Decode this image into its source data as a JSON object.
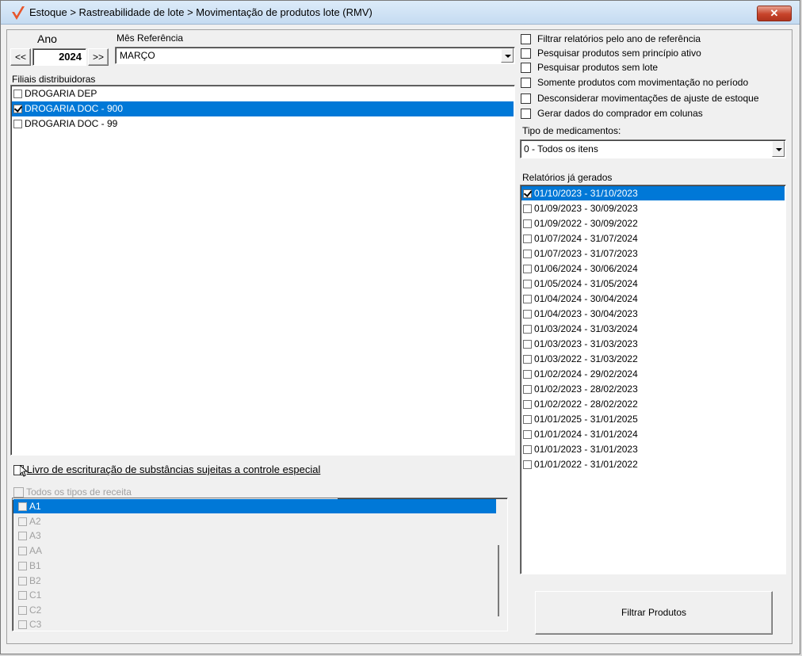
{
  "window": {
    "title": "Estoque > Rastreabilidade de lote > Movimentação de produtos lote (RMV)",
    "close_label": "✕"
  },
  "period": {
    "year_label": "Ano",
    "year_value": "2024",
    "prev_label": "<<",
    "next_label": ">>",
    "month_label": "Mês Referência",
    "month_value": "MARÇO"
  },
  "branches": {
    "label": "Filiais distribuidoras",
    "items": [
      {
        "label": "DROGARIA DEP",
        "checked": false,
        "selected": false
      },
      {
        "label": "DROGARIA DOC - 900",
        "checked": true,
        "selected": true
      },
      {
        "label": "DROGARIA DOC - 99",
        "checked": false,
        "selected": false
      }
    ]
  },
  "special_book": {
    "label": "Livro de escrituração de substâncias sujeitas a controle especial",
    "checked": false
  },
  "prescriptions": {
    "all_label": "Todos os tipos de receita",
    "items": [
      "A1",
      "A2",
      "A3",
      "AA",
      "B1",
      "B2",
      "C1",
      "C2",
      "C3"
    ]
  },
  "options": [
    {
      "label": "Filtrar relatórios pelo ano de referência",
      "checked": false
    },
    {
      "label": "Pesquisar produtos sem princípio ativo",
      "checked": false
    },
    {
      "label": "Pesquisar produtos sem lote",
      "checked": false
    },
    {
      "label": "Somente produtos com movimentação no período",
      "checked": false
    },
    {
      "label": "Desconsiderar movimentações de ajuste de estoque",
      "checked": false
    },
    {
      "label": "Gerar dados do comprador em colunas",
      "checked": false
    }
  ],
  "medication_type": {
    "label": "Tipo de medicamentos:",
    "value": "0 - Todos os itens"
  },
  "reports": {
    "label": "Relatórios já gerados",
    "items": [
      {
        "label": "01/10/2023 - 31/10/2023",
        "checked": true,
        "selected": true
      },
      {
        "label": "01/09/2023 - 30/09/2023",
        "checked": false,
        "selected": false
      },
      {
        "label": "01/09/2022 - 30/09/2022",
        "checked": false,
        "selected": false
      },
      {
        "label": "01/07/2024 - 31/07/2024",
        "checked": false,
        "selected": false
      },
      {
        "label": "01/07/2023 - 31/07/2023",
        "checked": false,
        "selected": false
      },
      {
        "label": "01/06/2024 - 30/06/2024",
        "checked": false,
        "selected": false
      },
      {
        "label": "01/05/2024 - 31/05/2024",
        "checked": false,
        "selected": false
      },
      {
        "label": "01/04/2024 - 30/04/2024",
        "checked": false,
        "selected": false
      },
      {
        "label": "01/04/2023 - 30/04/2023",
        "checked": false,
        "selected": false
      },
      {
        "label": "01/03/2024 - 31/03/2024",
        "checked": false,
        "selected": false
      },
      {
        "label": "01/03/2023 - 31/03/2023",
        "checked": false,
        "selected": false
      },
      {
        "label": "01/03/2022 - 31/03/2022",
        "checked": false,
        "selected": false
      },
      {
        "label": "01/02/2024 - 29/02/2024",
        "checked": false,
        "selected": false
      },
      {
        "label": "01/02/2023 - 28/02/2023",
        "checked": false,
        "selected": false
      },
      {
        "label": "01/02/2022 - 28/02/2022",
        "checked": false,
        "selected": false
      },
      {
        "label": "01/01/2025 - 31/01/2025",
        "checked": false,
        "selected": false
      },
      {
        "label": "01/01/2024 - 31/01/2024",
        "checked": false,
        "selected": false
      },
      {
        "label": "01/01/2023 - 31/01/2023",
        "checked": false,
        "selected": false
      },
      {
        "label": "01/01/2022 - 31/01/2022",
        "checked": false,
        "selected": false
      }
    ]
  },
  "filter_button": {
    "label": "Filtrar Produtos"
  },
  "colors": {
    "selection": "#0078d7",
    "logo": "#e8552b",
    "close": "#c7432a"
  },
  "icons": {
    "logo": "checkmark-logo-icon",
    "close": "close-icon",
    "dropdown": "chevron-down-icon",
    "cursor": "mouse-pointer-icon"
  }
}
